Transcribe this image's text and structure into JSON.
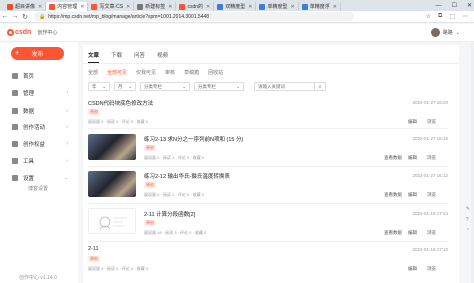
{
  "browser": {
    "tabs": [
      {
        "label": "超目讲像",
        "color": "#f25022",
        "active": false
      },
      {
        "label": "内容管理",
        "color": "#fc5531",
        "active": true
      },
      {
        "label": "写文章-CS",
        "color": "#fc5531",
        "active": false
      },
      {
        "label": "新建标签",
        "color": "#777777",
        "active": false
      },
      {
        "label": "csdn的",
        "color": "#fc5531",
        "active": false
      },
      {
        "label": "双精度型",
        "color": "#3b7ddd",
        "active": false
      },
      {
        "label": "单精度型",
        "color": "#3b7ddd",
        "active": false
      },
      {
        "label": "单精度浮",
        "color": "#3b7ddd",
        "active": false
      }
    ],
    "url": "https://mp.csdn.net/mp_blog/manage/article?spm=1001.2014.3001.5448",
    "window_controls": [
      "—",
      "☐",
      "✕"
    ]
  },
  "header": {
    "logo": "csdn",
    "title": "创作中心",
    "user": "路路"
  },
  "sidebar": {
    "publish_label": "发布",
    "items": [
      {
        "label": "首页",
        "icon": "home-icon",
        "chevron": ""
      },
      {
        "label": "管理",
        "icon": "folder-icon",
        "chevron": "›"
      },
      {
        "label": "数据",
        "icon": "chart-icon",
        "chevron": "›"
      },
      {
        "label": "创作活动",
        "icon": "flag-icon",
        "chevron": "›"
      },
      {
        "label": "创作权益",
        "icon": "badge-icon",
        "chevron": "›"
      },
      {
        "label": "工具",
        "icon": "tool-icon",
        "chevron": "›"
      },
      {
        "label": "设置",
        "icon": "settings-icon",
        "chevron": "⌄"
      }
    ],
    "sub_item": "博客设置",
    "version": "创作中心 v1.14.0"
  },
  "main": {
    "tabs": [
      "文章",
      "下载",
      "问答",
      "视频"
    ],
    "active_tab": "文章",
    "filters": [
      "全部",
      "全部可见",
      "仅我可见",
      "审核",
      "草稿箱",
      "回收站"
    ],
    "active_filter": "全部可见",
    "selects": [
      "年",
      "月",
      "分类专栏",
      "分类专栏"
    ],
    "search_placeholder": "请输入关键词",
    "articles": [
      {
        "title": "CSDN代码块底色修改方法",
        "tag": "原创",
        "meta": "展现量 0 · 阅读 0 · 评论 0 · 收藏 0",
        "date": "2022-01-27 16:20",
        "actions": [
          "编辑",
          "浏览"
        ],
        "thumb": "none"
      },
      {
        "title": "练习2-13 求N分之一序列前N项和 (15 分)",
        "tag": "原创",
        "meta": "展现量 0 · 阅读 1 · 评论 0 · 收藏 0",
        "date": "2022-01-27 16:15",
        "actions": [
          "查看数据",
          "编辑",
          "浏览"
        ],
        "thumb": "anime"
      },
      {
        "title": "练习2-12 输出华氏-摄氏温度转换表",
        "tag": "原创",
        "meta": "展现量 0 · 阅读 1 · 评论 0 · 收藏 0",
        "date": "2022-01-27 16:12",
        "actions": [
          "查看数据",
          "编辑",
          "浏览"
        ],
        "thumb": "anime"
      },
      {
        "title": "2-11 计算分段函数[2]",
        "tag": "原创",
        "meta": "展现量 18 · 阅读 3 · 评论 0 · 收藏 0",
        "date": "2022-01-19 17:24",
        "actions": [
          "查看数据",
          "编辑",
          "浏览"
        ],
        "thumb": "sketch"
      },
      {
        "title": "2-11",
        "tag": "原创",
        "meta": "展现量 0 · 阅读 0 · 评论 0 · 收藏 0",
        "date": "2022-01-19 17:10",
        "actions": [
          "编辑",
          "浏览"
        ],
        "thumb": "none"
      }
    ]
  },
  "colors": {
    "accent": "#fc5531"
  }
}
